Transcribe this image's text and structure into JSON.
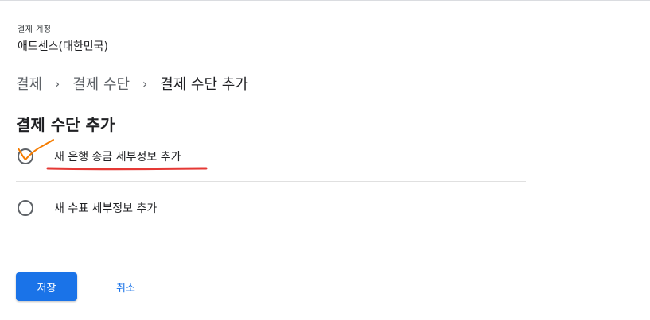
{
  "account": {
    "label": "결제 계정",
    "value": "애드센스(대한민국)"
  },
  "breadcrumb": {
    "items": [
      "결제",
      "결제 수단",
      "결제 수단 추가"
    ],
    "separator": "›"
  },
  "section": {
    "title": "결제 수단 추가"
  },
  "options": [
    {
      "label": "새 은행 송금 세부정보 추가",
      "selected": false
    },
    {
      "label": "새 수표 세부정보 추가",
      "selected": false
    }
  ],
  "actions": {
    "save_label": "저장",
    "cancel_label": "취소"
  },
  "colors": {
    "primary": "#1a73e8",
    "annotation_underline": "#e53935",
    "annotation_check": "#f57c00"
  }
}
